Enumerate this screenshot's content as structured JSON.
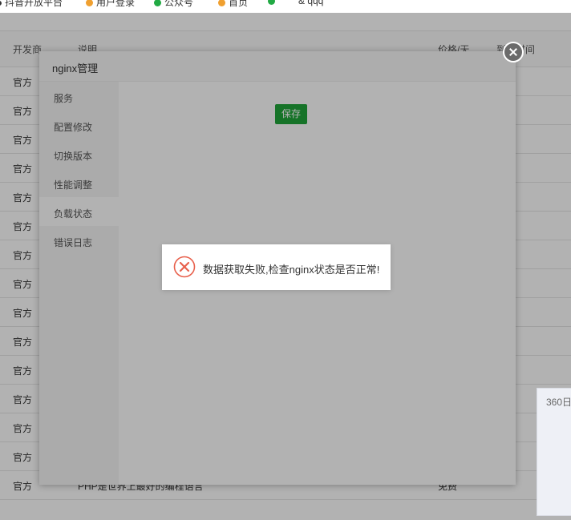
{
  "bookmarks": [
    {
      "label": "抖音开放平台",
      "color": "#333333"
    },
    {
      "label": "用户登录",
      "color": "#f0a030"
    },
    {
      "label": "公众号",
      "color": "#22aa44"
    },
    {
      "label": "首页",
      "color": "#f0a030"
    },
    {
      "label": "",
      "color": "#22aa44"
    },
    {
      "label": "& qqq",
      "color": "#888888"
    }
  ],
  "table": {
    "headers": {
      "developer": "开发商",
      "description": "说明",
      "price": "价格/天",
      "expiry": "到期时间"
    },
    "rows": [
      "官方",
      "官方",
      "官方",
      "官方",
      "官方",
      "官方",
      "官方",
      "官方",
      "官方",
      "官方",
      "官方",
      "官方",
      "官方",
      "官方",
      "官方"
    ],
    "last_row_description": "PHP是世界上最好的编程语言",
    "last_row_price": "免费"
  },
  "modal": {
    "title": "nginx管理",
    "menu": [
      {
        "label": "服务",
        "active": false
      },
      {
        "label": "配置修改",
        "active": false
      },
      {
        "label": "切换版本",
        "active": false
      },
      {
        "label": "性能调整",
        "active": false
      },
      {
        "label": "负载状态",
        "active": true
      },
      {
        "label": "错误日志",
        "active": false
      }
    ],
    "save_label": "保存"
  },
  "toast": {
    "message": "数据获取失败,检查nginx状态是否正常!",
    "icon": "error-circle-icon",
    "color": "#e8604c"
  },
  "popup": {
    "text": "360日"
  },
  "colors": {
    "accent": "#20a53a",
    "error": "#e8604c"
  }
}
